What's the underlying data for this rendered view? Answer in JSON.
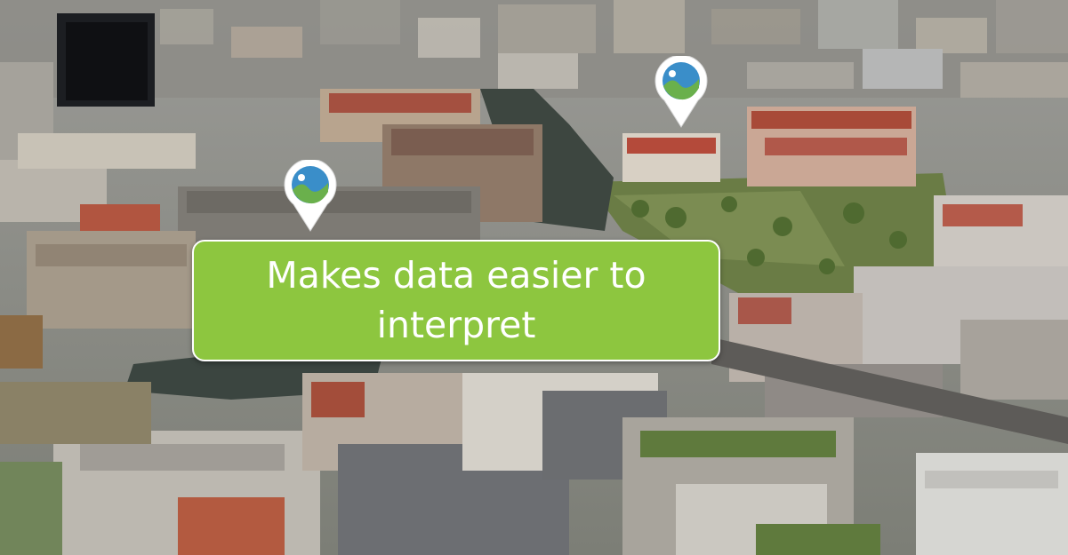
{
  "scene": {
    "subject": "aerial-3d-city-view",
    "colors": {
      "callout_fill": "#8dc63f",
      "callout_border": "#ffffff",
      "pin_body": "#ffffff",
      "pin_badge": "#3a8ec9",
      "pin_hill": "#6ab04c"
    }
  },
  "callout": {
    "text": "Makes data easier to interpret"
  },
  "markers": [
    {
      "icon": "map-pin-icon"
    },
    {
      "icon": "map-pin-icon"
    }
  ]
}
